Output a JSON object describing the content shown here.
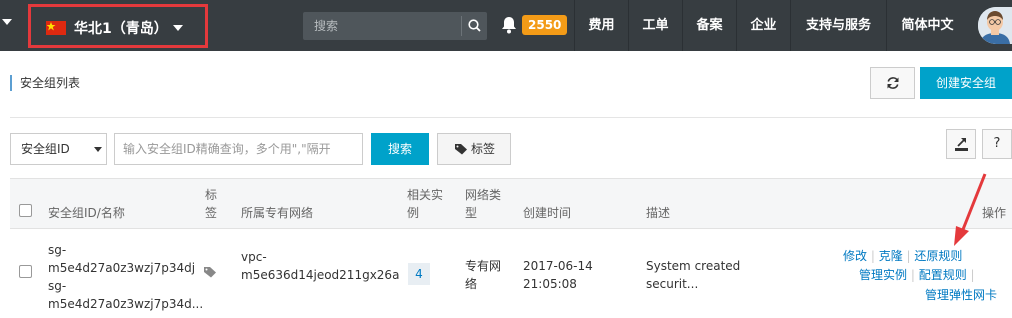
{
  "topbar": {
    "region": "华北1（青岛）",
    "search_placeholder": "搜索",
    "notification_count": "2550",
    "nav": [
      "费用",
      "工单",
      "备案",
      "企业",
      "支持与服务",
      "简体中文"
    ]
  },
  "page": {
    "title": "安全组列表",
    "create_label": "创建安全组"
  },
  "filter": {
    "select_value": "安全组ID",
    "input_placeholder": "输入安全组ID精确查询，多个用\",\"隔开",
    "search_label": "搜索",
    "tag_label": "标签",
    "help_label": "?"
  },
  "table": {
    "headers": {
      "id_name": "安全组ID/名称",
      "tag_1": "标",
      "tag_2": "签",
      "vpc": "所属专有网络",
      "instances_1": "相关实",
      "instances_2": "例",
      "net_type_1": "网络类",
      "net_type_2": "型",
      "created": "创建时间",
      "desc": "描述",
      "ops": "操作"
    },
    "rows": [
      {
        "id_1": "sg-",
        "id_2": "m5e4d27a0z3wzj7p34dj",
        "name_1": "sg-",
        "name_2": "m5e4d27a0z3wzj7p34d...",
        "vpc_1": "vpc-",
        "vpc_2": "m5e636d14jeod211gx26a",
        "instances": "4",
        "net_type_1": "专有网",
        "net_type_2": "络",
        "created_1": "2017-06-14",
        "created_2": "21:05:08",
        "desc_1": "System created",
        "desc_2": "securit...",
        "actions": {
          "modify": "修改",
          "clone": "克隆",
          "restore": "还原规则",
          "manage_instances": "管理实例",
          "configure_rules": "配置规则",
          "manage_eni": "管理弹性网卡"
        }
      }
    ]
  },
  "colors": {
    "topbar": "#373d41",
    "accent": "#00a2ca",
    "badge": "#f39b17",
    "highlight": "#e4393c",
    "link": "#0079c2"
  }
}
